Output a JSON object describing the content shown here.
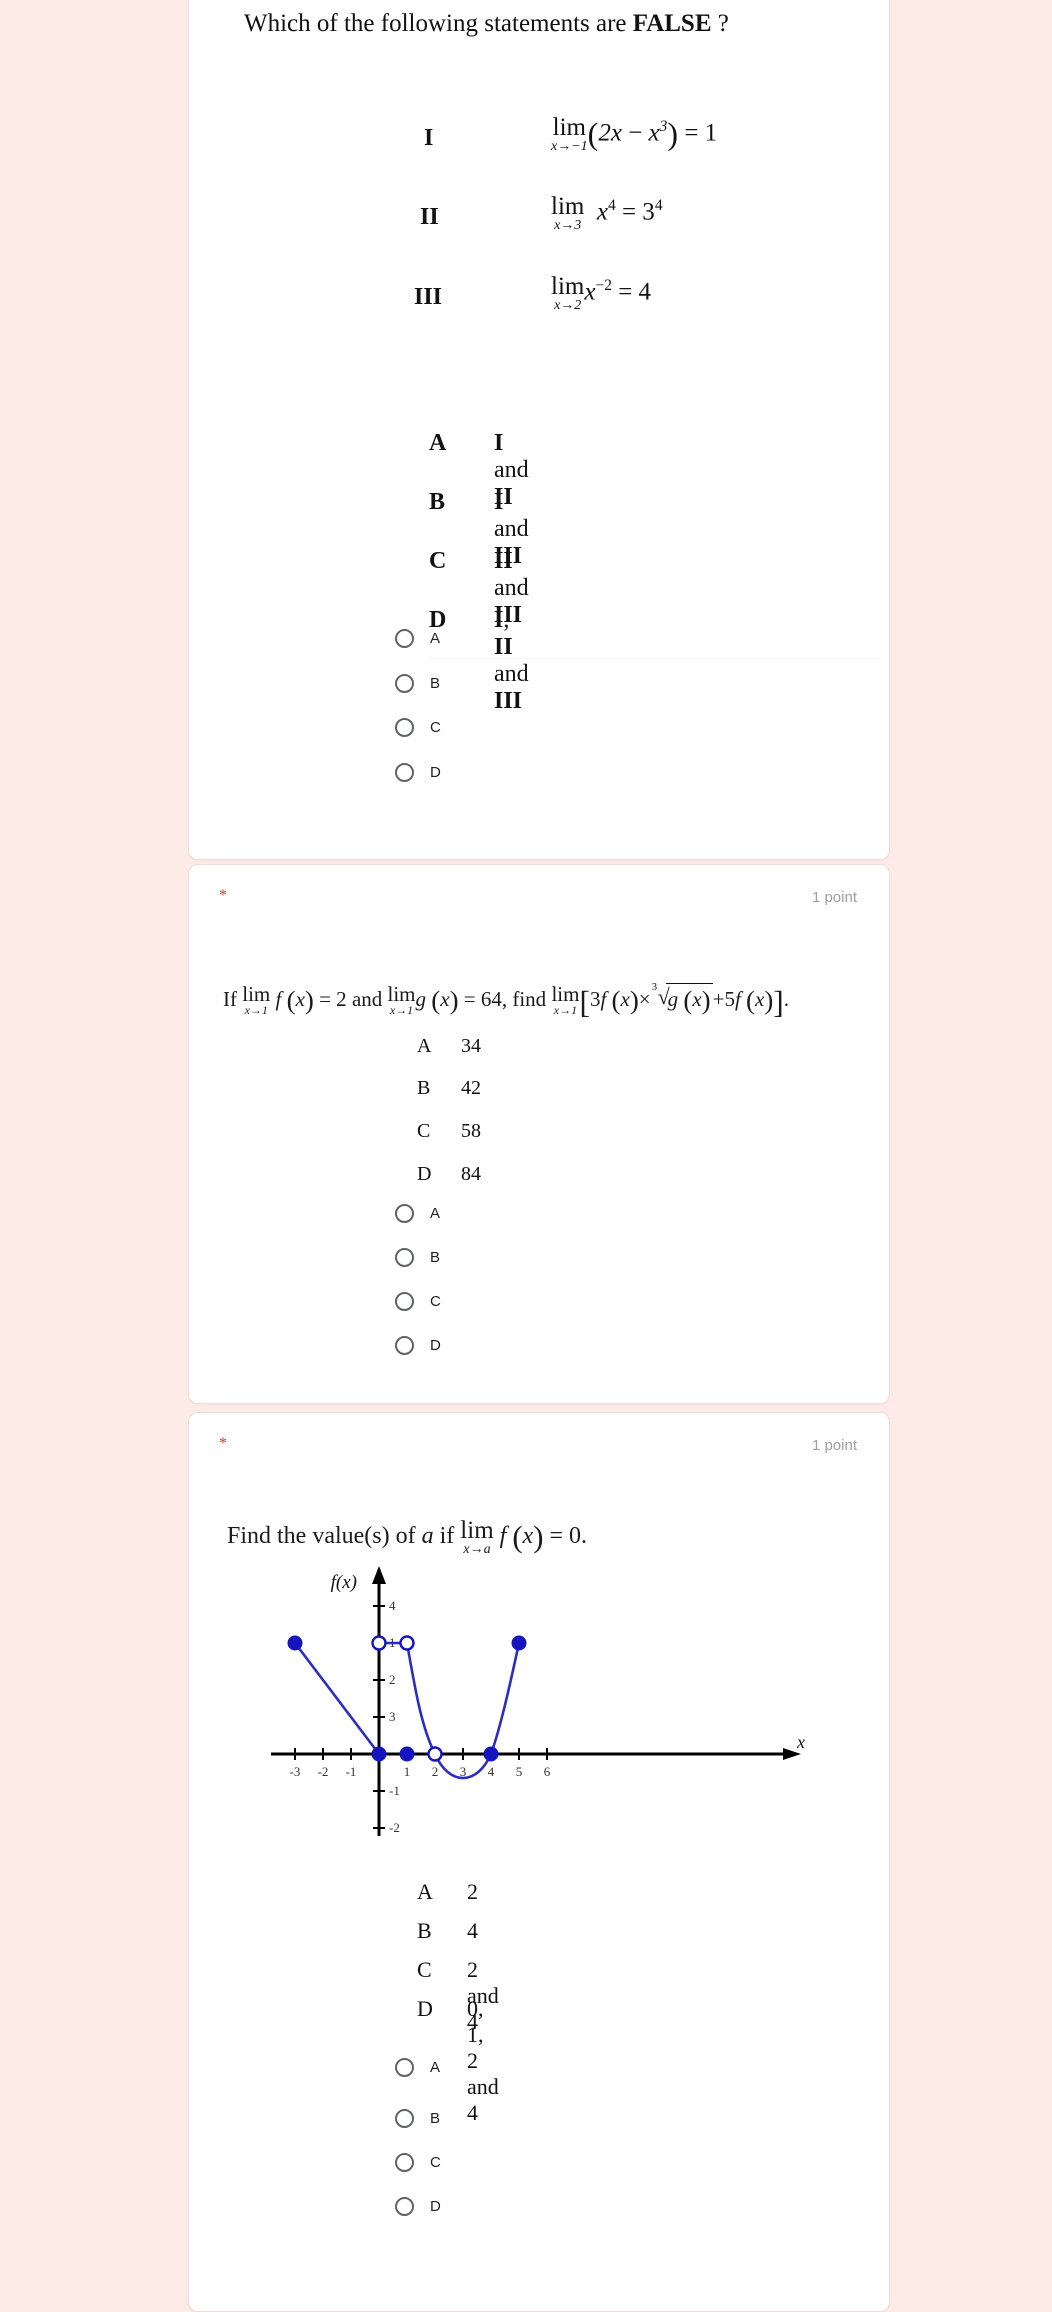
{
  "page": {
    "background_color": "#fcebe7",
    "card_color": "#ffffff",
    "required_marker": "*",
    "points_label": "1 point",
    "feedback_icon": "report-feedback-icon"
  },
  "questions": [
    {
      "id": "q1",
      "title_prefix": "Which of the following statements are ",
      "title_bold": "FALSE",
      "title_suffix": " ?",
      "statements": [
        {
          "roman": "I",
          "limit_op": "lim",
          "limit_sub": "x→−1",
          "body_open": "(",
          "body": "2x − x",
          "body_exp": "3",
          "body_close": ")",
          "equals": "= 1"
        },
        {
          "roman": "II",
          "limit_op": "lim",
          "limit_sub": "x→3",
          "body": "x",
          "body_exp": "4",
          "equals": "= 3",
          "equals_exp": "4"
        },
        {
          "roman": "III",
          "limit_op": "lim",
          "limit_sub": "x→2",
          "body": "x",
          "body_exp": "−2",
          "equals": "= 4"
        }
      ],
      "image_choices": [
        {
          "label": "A",
          "text_parts": [
            "I",
            " and ",
            "II"
          ]
        },
        {
          "label": "B",
          "text_parts": [
            "I",
            " and ",
            "III"
          ]
        },
        {
          "label": "C",
          "text_parts": [
            "II",
            " and ",
            "III"
          ]
        },
        {
          "label": "D",
          "text_parts": [
            "I",
            ", ",
            "II",
            " and ",
            "III"
          ]
        }
      ],
      "radio_options": [
        "A",
        "B",
        "C",
        "D"
      ]
    },
    {
      "id": "q2",
      "prompt": {
        "lead": "If ",
        "limit1_sub": "x→1",
        "f_of_x": "f (x)",
        "eq1": "= 2",
        "mid": " and ",
        "limit2_sub": "x→1",
        "g_of_x": "g (x)",
        "eq2": "= 64,",
        "find": " find ",
        "limit3_sub": "x→1",
        "bracket_open": "[",
        "term1": "3f (x)×",
        "radical_index": "3",
        "radical_body": "g (x)",
        "term2": "+5f (x)",
        "bracket_close": "]",
        "period": "."
      },
      "image_choices": [
        {
          "label": "A",
          "text": "34"
        },
        {
          "label": "B",
          "text": "42"
        },
        {
          "label": "C",
          "text": "58"
        },
        {
          "label": "D",
          "text": "84"
        }
      ],
      "radio_options": [
        "A",
        "B",
        "C",
        "D"
      ]
    },
    {
      "id": "q3",
      "prompt": {
        "lead": "Find the value(s) of ",
        "var": "a",
        "mid": " if ",
        "limit_op": "lim",
        "limit_sub": "x→a",
        "fx": "f (x)",
        "eq": "= 0",
        "period": "."
      },
      "image_choices": [
        {
          "label": "A",
          "text": "2"
        },
        {
          "label": "B",
          "text": "4"
        },
        {
          "label": "C",
          "text": "2 and 4"
        },
        {
          "label": "D",
          "text": "0, 1, 2 and 4"
        }
      ],
      "radio_options": [
        "A",
        "B",
        "C",
        "D"
      ]
    }
  ],
  "chart_data": {
    "type": "line",
    "title": "",
    "ylabel": "f(x)",
    "xlabel": "x",
    "xlim": [
      -3.6,
      6.8
    ],
    "ylim": [
      -2.6,
      4.4
    ],
    "xticks": [
      -3,
      -2,
      -1,
      1,
      2,
      3,
      4,
      5,
      6
    ],
    "yticks": [
      -2,
      -1,
      1,
      2,
      3,
      4
    ],
    "xtick_labels": [
      "-3",
      "-2",
      "-1",
      "1",
      "2",
      "3",
      "4",
      "5",
      "6"
    ],
    "ytick_labels": [
      "-2",
      "-1",
      "1",
      "2",
      "3",
      "4"
    ],
    "grid": false,
    "curve_color": "#2b2bc6",
    "series": [
      {
        "name": "segment-1",
        "kind": "line",
        "points": [
          [
            -3,
            3
          ],
          [
            0,
            0
          ]
        ]
      },
      {
        "name": "segment-2",
        "kind": "line",
        "points": [
          [
            0,
            3
          ],
          [
            1,
            3
          ]
        ]
      },
      {
        "name": "segment-3",
        "kind": "curve",
        "points": [
          [
            1,
            3
          ],
          [
            1.5,
            2.0
          ],
          [
            2,
            0
          ]
        ]
      },
      {
        "name": "segment-4",
        "kind": "parabola",
        "points": [
          [
            2,
            0
          ],
          [
            3,
            -1
          ],
          [
            4,
            0
          ],
          [
            5,
            3
          ]
        ]
      }
    ],
    "filled_points": [
      [
        -3,
        3
      ],
      [
        0,
        0
      ],
      [
        1,
        0
      ],
      [
        4,
        0
      ],
      [
        5,
        3
      ]
    ],
    "open_points": [
      [
        0,
        3
      ],
      [
        1,
        3
      ],
      [
        2,
        0
      ]
    ]
  }
}
